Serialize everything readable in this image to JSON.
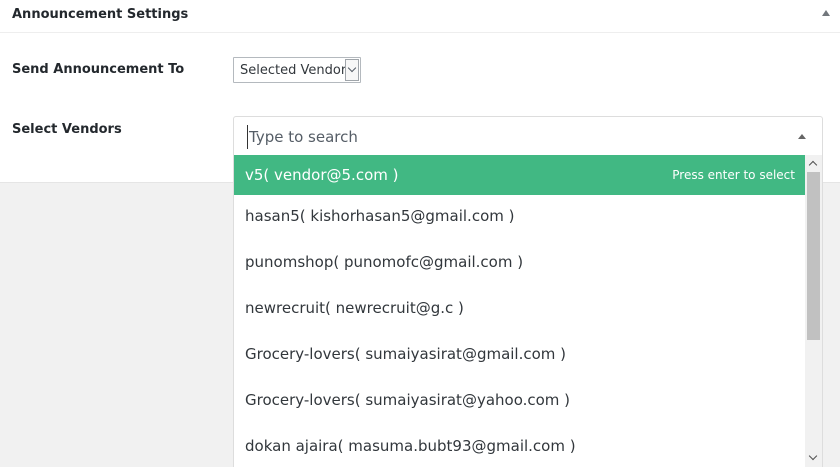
{
  "panel": {
    "title": "Announcement Settings"
  },
  "send_to": {
    "label": "Send Announcement To",
    "selected": "Selected Vendor"
  },
  "vendors": {
    "label": "Select Vendors",
    "search_placeholder": "Type to search",
    "enter_hint": "Press enter to select",
    "options": [
      "v5( vendor@5.com )",
      "hasan5( kishorhasan5@gmail.com )",
      "punomshop( punomofc@gmail.com )",
      "newrecruit( newrecruit@g.c )",
      "Grocery-lovers( sumaiyasirat@gmail.com )",
      "Grocery-lovers( sumaiyasirat@yahoo.com )",
      "dokan ajaira( masuma.bubt93@gmail.com )"
    ]
  },
  "colors": {
    "highlight": "#41b883",
    "background": "#f1f1f1",
    "panel": "#ffffff"
  }
}
